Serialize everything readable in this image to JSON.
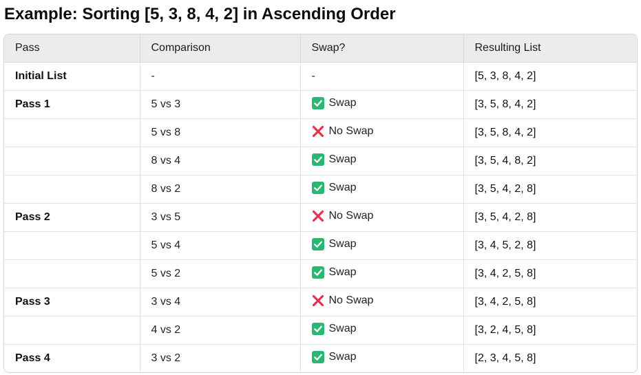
{
  "page": {
    "title": "Example: Sorting [5, 3, 8, 4, 2] in Ascending Order"
  },
  "table": {
    "headers": [
      "Pass",
      "Comparison",
      "Swap?",
      "Resulting List"
    ],
    "rows": [
      {
        "pass": "Initial List",
        "comparison": "-",
        "swap": "-",
        "swap_icon": "",
        "result": "[5, 3, 8, 4, 2]"
      },
      {
        "pass": "Pass 1",
        "comparison": "5 vs 3",
        "swap": "Swap",
        "swap_icon": "check-box-icon",
        "result": "[3, 5, 8, 4, 2]"
      },
      {
        "pass": "",
        "comparison": "5 vs 8",
        "swap": "No Swap",
        "swap_icon": "cross-mark-icon",
        "result": "[3, 5, 8, 4, 2]"
      },
      {
        "pass": "",
        "comparison": "8 vs 4",
        "swap": "Swap",
        "swap_icon": "check-box-icon",
        "result": "[3, 5, 4, 8, 2]"
      },
      {
        "pass": "",
        "comparison": "8 vs 2",
        "swap": "Swap",
        "swap_icon": "check-box-icon",
        "result": "[3, 5, 4, 2, 8]"
      },
      {
        "pass": "Pass 2",
        "comparison": "3 vs 5",
        "swap": "No Swap",
        "swap_icon": "cross-mark-icon",
        "result": "[3, 5, 4, 2, 8]"
      },
      {
        "pass": "",
        "comparison": "5 vs 4",
        "swap": "Swap",
        "swap_icon": "check-box-icon",
        "result": "[3, 4, 5, 2, 8]"
      },
      {
        "pass": "",
        "comparison": "5 vs 2",
        "swap": "Swap",
        "swap_icon": "check-box-icon",
        "result": "[3, 4, 2, 5, 8]"
      },
      {
        "pass": "Pass 3",
        "comparison": "3 vs 4",
        "swap": "No Swap",
        "swap_icon": "cross-mark-icon",
        "result": "[3, 4, 2, 5, 8]"
      },
      {
        "pass": "",
        "comparison": "4 vs 2",
        "swap": "Swap",
        "swap_icon": "check-box-icon",
        "result": "[3, 2, 4, 5, 8]"
      },
      {
        "pass": "Pass 4",
        "comparison": "3 vs 2",
        "swap": "Swap",
        "swap_icon": "check-box-icon",
        "result": "[2, 3, 4, 5, 8]"
      }
    ]
  },
  "colors": {
    "check_green": "#2bb673",
    "cross_red": "#e8314f",
    "header_bg": "#ececec",
    "border": "#d9d9d9"
  }
}
